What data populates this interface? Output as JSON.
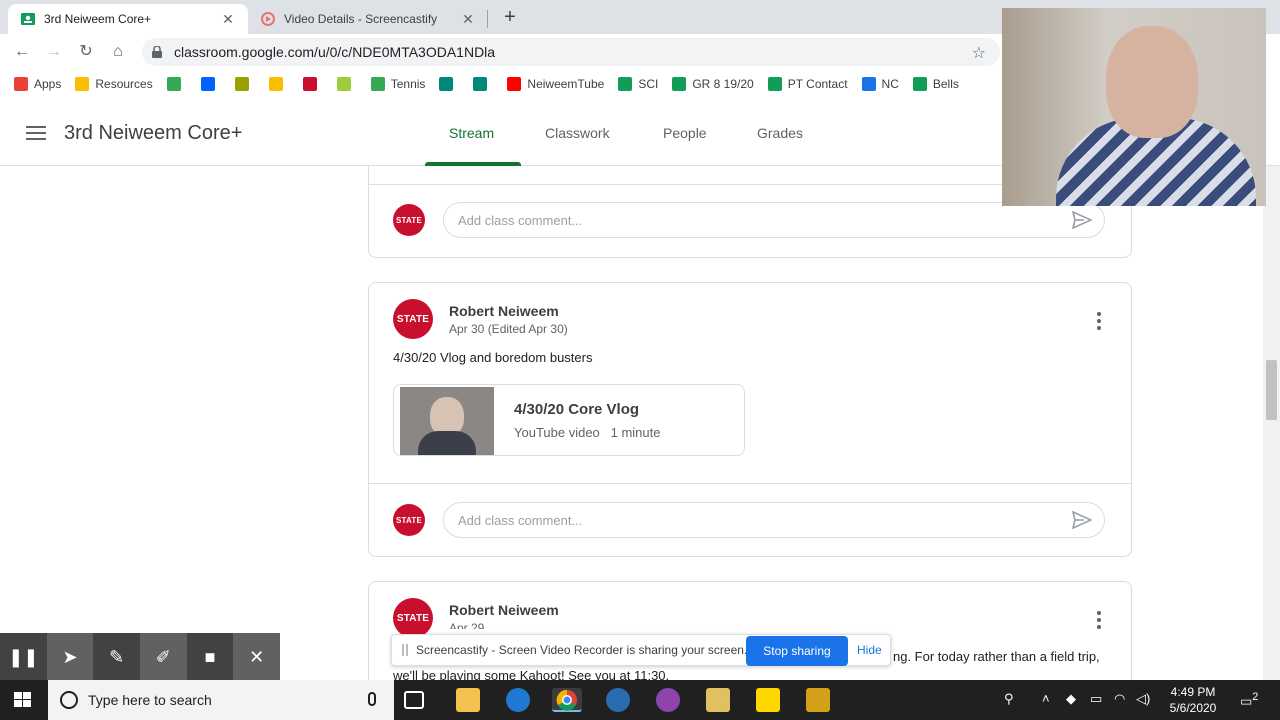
{
  "browser": {
    "tabs": [
      {
        "title": "3rd Neiweem Core+",
        "active": true
      },
      {
        "title": "Video Details - Screencastify",
        "active": false
      }
    ],
    "url": "classroom.google.com/u/0/c/NDE0MTA3ODA1NDla"
  },
  "bookmarks": [
    {
      "label": "Apps",
      "color": "#ea4335"
    },
    {
      "label": "Resources",
      "color": "#fbbc04"
    },
    {
      "label": "",
      "color": "#34a853"
    },
    {
      "label": "",
      "color": "#0061fe"
    },
    {
      "label": "",
      "color": "#9aa000"
    },
    {
      "label": "",
      "color": "#fbbc04"
    },
    {
      "label": "",
      "color": "#c8102e"
    },
    {
      "label": "",
      "color": "#9ccc3c"
    },
    {
      "label": "Tennis",
      "color": "#34a853"
    },
    {
      "label": "",
      "color": "#00897b"
    },
    {
      "label": "",
      "color": "#00897b"
    },
    {
      "label": "NeiweemTube",
      "color": "#ff0000"
    },
    {
      "label": "SCI",
      "color": "#0f9d58"
    },
    {
      "label": "GR 8 19/20",
      "color": "#0f9d58"
    },
    {
      "label": "PT Contact",
      "color": "#0f9d58"
    },
    {
      "label": "NC",
      "color": "#1a73e8"
    },
    {
      "label": "Bells",
      "color": "#0f9d58"
    }
  ],
  "classroom": {
    "class_name": "3rd Neiweem Core+",
    "nav": [
      "Stream",
      "Classwork",
      "People",
      "Grades"
    ],
    "active_nav": "Stream",
    "accent": "#137333"
  },
  "avatar_text": "STATE",
  "comment_placeholder": "Add class comment...",
  "posts": [
    {
      "author": "Robert Neiweem",
      "date": "Apr 30 (Edited Apr 30)",
      "body": "4/30/20 Vlog and boredom busters",
      "attachment": {
        "title": "4/30/20 Core Vlog",
        "type": "YouTube video",
        "duration": "1 minute"
      }
    },
    {
      "author": "Robert Neiweem",
      "date": "Apr 29",
      "body_visible_end": "ng. For today rather than a field trip,",
      "body_line2": "we'll be playing some Kahoot! See you at 11:30."
    }
  ],
  "screencastify": {
    "message": "Screencastify - Screen Video Recorder is sharing your screen.",
    "stop_label": "Stop sharing",
    "hide_label": "Hide"
  },
  "taskbar": {
    "search_placeholder": "Type here to search",
    "time": "4:49 PM",
    "date": "5/6/2020",
    "notifications": "2"
  }
}
